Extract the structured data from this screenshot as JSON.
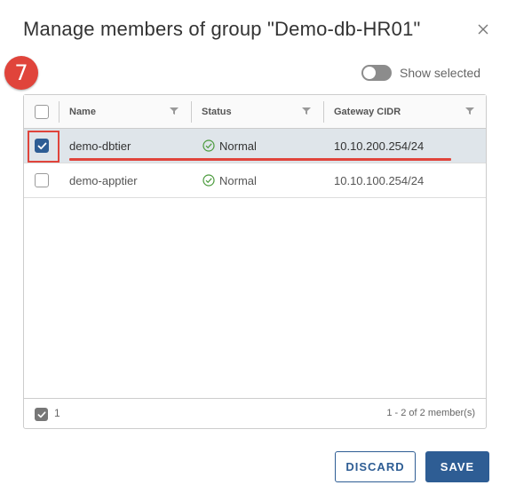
{
  "dialog": {
    "title": "Manage members of group \"Demo-db-HR01\"",
    "step_number": "7"
  },
  "toggle": {
    "label": "Show selected",
    "on": false
  },
  "grid": {
    "columns": [
      {
        "label": "Name"
      },
      {
        "label": "Status"
      },
      {
        "label": "Gateway CIDR"
      }
    ],
    "rows": [
      {
        "name": "demo-dbtier",
        "status": "Normal",
        "cidr": "10.10.200.254/24",
        "selected": true
      },
      {
        "name": "demo-apptier",
        "status": "Normal",
        "cidr": "10.10.100.254/24",
        "selected": false
      }
    ],
    "footer": {
      "selected_count": "1",
      "range": "1 - 2 of 2 member(s)"
    }
  },
  "buttons": {
    "discard": "DISCARD",
    "save": "SAVE"
  },
  "colors": {
    "accent": "#2e5d94",
    "annotation": "#e0443b",
    "status_ok": "#4a9a3c",
    "selected_row": "#dfe5ea"
  }
}
